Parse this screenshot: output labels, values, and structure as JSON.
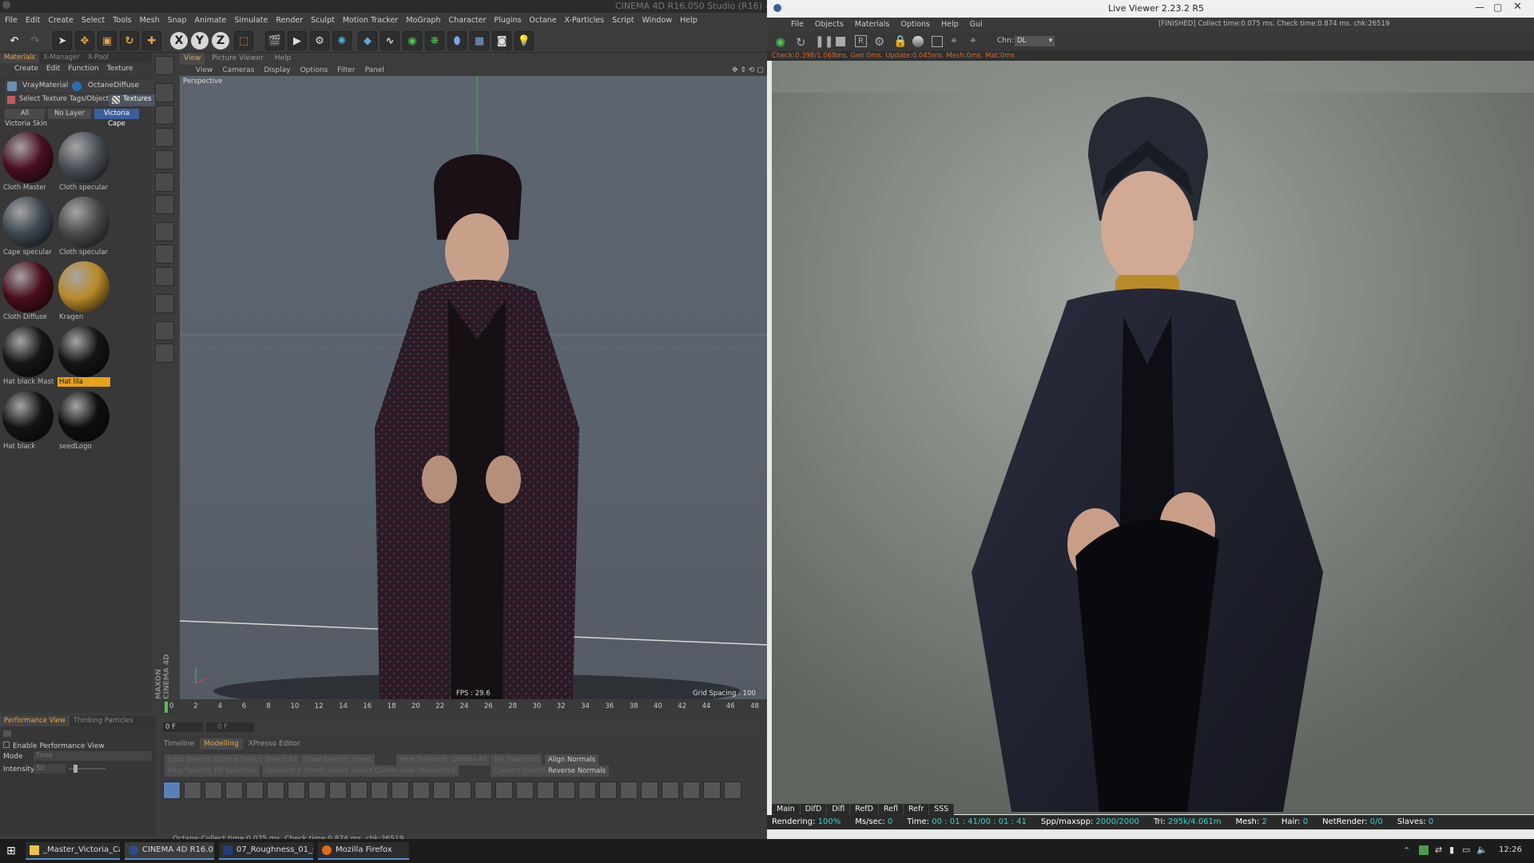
{
  "c4d": {
    "title": "CINEMA 4D R16.050 Studio (R16) - [0",
    "menus": [
      "File",
      "Edit",
      "Create",
      "Select",
      "Tools",
      "Mesh",
      "Snap",
      "Animate",
      "Simulate",
      "Render",
      "Sculpt",
      "Motion Tracker",
      "MoGraph",
      "Character",
      "Plugins",
      "Octane",
      "X-Particles",
      "Script",
      "Window",
      "Help"
    ],
    "panel_tabs": [
      "Materials",
      "X-Manager",
      "X-Pool"
    ],
    "panel_menu": [
      "Create",
      "Edit",
      "Function",
      "Texture"
    ],
    "materials_header": [
      "VrayMaterial",
      "OctaneDiffuse"
    ],
    "select_tags": "Select Texture Tags/Objects",
    "textures_btn": "Textures",
    "layers": [
      "All",
      "No Layer",
      "Victoria Cape"
    ],
    "skin_label": "Victoria Skin",
    "materials": [
      {
        "name": "Cloth Master",
        "color": "#4a0f22"
      },
      {
        "name": "Cloth specular m",
        "color": "#4a4f57"
      },
      {
        "name": "Cape specular",
        "color": "#3d4650"
      },
      {
        "name": "Cloth specular",
        "color": "#4a4a4a"
      },
      {
        "name": "Cloth Diffuse",
        "color": "#4a0d1c"
      },
      {
        "name": "Kragen",
        "color": "#b98a28"
      },
      {
        "name": "Hat black Master",
        "color": "#151515"
      },
      {
        "name": "Hat lila",
        "color": "#141414",
        "highlight": true
      },
      {
        "name": "Hat black",
        "color": "#131313"
      },
      {
        "name": "seedLogo",
        "color": "#0e0e0e"
      }
    ],
    "viewport_tabs": [
      "View",
      "Picture Viewer",
      "Help"
    ],
    "viewport_menu": [
      "View",
      "Cameras",
      "Display",
      "Options",
      "Filter",
      "Panel"
    ],
    "viewport_label": "Perspective",
    "fps": "FPS : 29.6",
    "grid": "Grid Spacing : 100 cm",
    "timeline_ticks": [
      "0",
      "2",
      "4",
      "6",
      "8",
      "10",
      "12",
      "14",
      "16",
      "18",
      "20",
      "22",
      "24",
      "26",
      "28",
      "30",
      "32",
      "34",
      "36",
      "38",
      "40",
      "42",
      "44",
      "46",
      "48"
    ],
    "frame_field": "0 F",
    "frame_field2": "0 F",
    "perf_tabs": [
      "Performance View",
      "Thinking Particles"
    ],
    "enable_perf": "Enable Performance View",
    "mode_label": "Mode",
    "mode_value": "Time",
    "intensity_label": "Intensity",
    "intensity_value": "50",
    "bottom_tabs": [
      "Timeline",
      "Modelling",
      "XPresso Editor"
    ],
    "mod_buttons": [
      [
        "Loop Selection",
        "Outline Selection",
        "Select All",
        "Grow Selection",
        "Invert",
        "Hide Selected",
        "Unhide All",
        "Set Selection",
        "Align Normals"
      ],
      [
        "Ring Selection",
        "Fill Selection",
        "Deselect All",
        "Shrink Selection",
        "Select Connected",
        "Hide Unselected",
        "",
        "Convert Selection",
        "Reverse Normals"
      ]
    ],
    "status": "Octane:Collect time:0.075 ms.  Check time:0.874 ms.  chk:26519",
    "brand": "MAXON CINEMA 4D"
  },
  "lv": {
    "title": "Live Viewer 2.23.2 R5",
    "menus": [
      "File",
      "Objects",
      "Materials",
      "Options",
      "Help",
      "Gui"
    ],
    "finished": "[FINISHED] Collect time:0.075 ms.  Check time:0.874 ms.  chk:26519",
    "chn_label": "Chn:",
    "chn_value": "DL",
    "stat_line": "Check:0.398/1.068ms. Gen:0ms. Update:0.045ms. Mesh:0ms. Mat:0ms",
    "bottom_tabs": [
      "Main",
      "DifD",
      "Difl",
      "RefD",
      "Refl",
      "Refr",
      "SSS"
    ],
    "info": {
      "rendering_label": "Rendering:",
      "rendering_val": "100%",
      "ms_label": "Ms/sec:",
      "ms_val": "0",
      "time_label": "Time:",
      "time_val": "00 : 01 : 41/00 : 01 : 41",
      "spp_label": "Spp/maxspp:",
      "spp_val": "2000/2000",
      "tri_label": "Tri:",
      "tri_val": "295k/4.061m",
      "mesh_label": "Mesh:",
      "mesh_val": "2",
      "hair_label": "Hair:",
      "hair_val": "0",
      "net_label": "NetRender:",
      "net_val": "0/0",
      "slaves_label": "Slaves:",
      "slaves_val": "0"
    }
  },
  "taskbar": {
    "items": [
      "_Master_Victoria_Cape",
      "CINEMA 4D R16.050 ...",
      "07_Roughness_01_01...",
      "Mozilla Firefox"
    ],
    "time": "12:26"
  }
}
